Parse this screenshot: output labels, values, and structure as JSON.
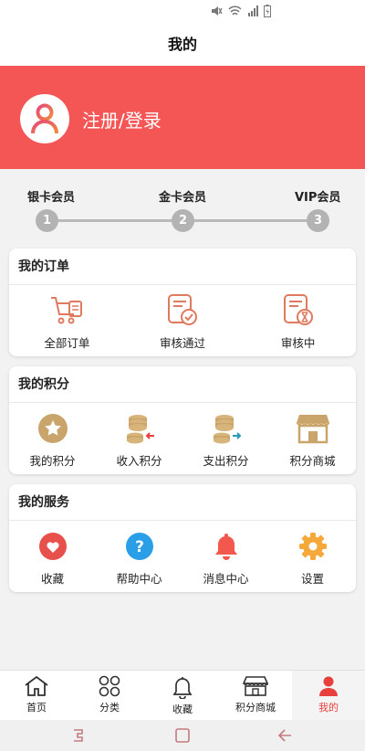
{
  "page": {
    "title": "我的"
  },
  "profile": {
    "login_text": "注册/登录",
    "banner_color": "#f45656"
  },
  "levels": [
    {
      "label": "银卡会员",
      "number": "1"
    },
    {
      "label": "金卡会员",
      "number": "2"
    },
    {
      "label": "VIP会员",
      "number": "3"
    }
  ],
  "orders": {
    "title": "我的订单",
    "items": [
      {
        "label": "全部订单",
        "icon": "cart-icon"
      },
      {
        "label": "审核通过",
        "icon": "approved-doc-icon"
      },
      {
        "label": "审核中",
        "icon": "pending-doc-icon"
      }
    ]
  },
  "points": {
    "title": "我的积分",
    "items": [
      {
        "label": "我的积分",
        "icon": "star-icon"
      },
      {
        "label": "收入积分",
        "icon": "coins-in-icon"
      },
      {
        "label": "支出积分",
        "icon": "coins-out-icon"
      },
      {
        "label": "积分商城",
        "icon": "shop-icon"
      }
    ]
  },
  "services": {
    "title": "我的服务",
    "items": [
      {
        "label": "收藏",
        "icon": "heart-icon"
      },
      {
        "label": "帮助中心",
        "icon": "help-icon"
      },
      {
        "label": "消息中心",
        "icon": "bell-icon"
      },
      {
        "label": "设置",
        "icon": "gear-icon"
      }
    ]
  },
  "bottom_nav": {
    "items": [
      {
        "label": "首页",
        "icon": "home-icon"
      },
      {
        "label": "分类",
        "icon": "category-icon"
      },
      {
        "label": "收藏",
        "icon": "bell-outline-icon"
      },
      {
        "label": "积分商城",
        "icon": "store-icon"
      },
      {
        "label": "我的",
        "icon": "person-icon",
        "active": true
      }
    ]
  },
  "colors": {
    "accent": "#e8413d",
    "order_icon": "#e07a5f",
    "points_icon": "#c9a46b"
  }
}
